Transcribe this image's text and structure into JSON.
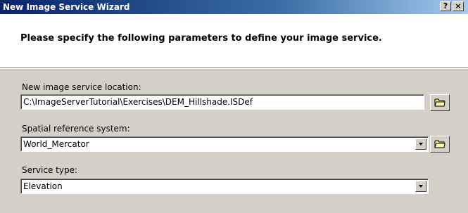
{
  "window": {
    "title": "New Image Service Wizard",
    "help_label": "?",
    "close_label": "×"
  },
  "header": {
    "instruction": "Please specify the following parameters to define your image service."
  },
  "form": {
    "location": {
      "label": "New image service location:",
      "value": "C:\\ImageServerTutorial\\Exercises\\DEM_Hillshade.ISDef",
      "browse_icon": "folder-icon"
    },
    "spatial_reference": {
      "label": "Spatial reference system:",
      "value": "World_Mercator",
      "browse_icon": "folder-icon"
    },
    "service_type": {
      "label": "Service type:",
      "value": "Elevation"
    }
  },
  "colors": {
    "titlebar_start": "#0a246a",
    "titlebar_end": "#a6caf0",
    "face": "#d4d0c8",
    "folder_yellow": "#f5e68c"
  }
}
